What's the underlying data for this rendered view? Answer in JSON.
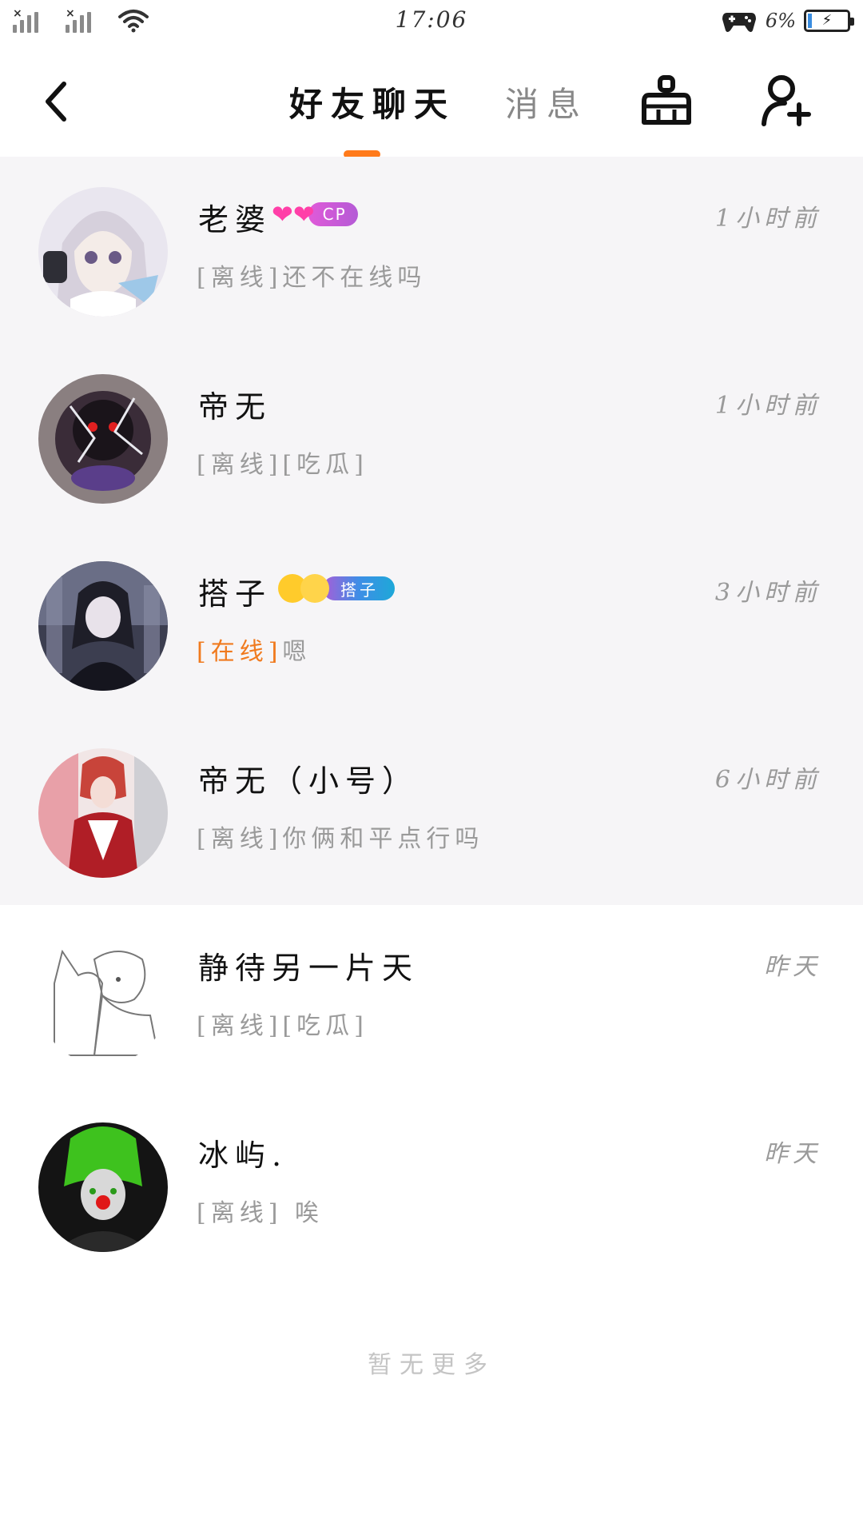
{
  "status_bar": {
    "time": "17:06",
    "battery_pct": "6%",
    "icons": [
      "signal-icon",
      "signal-icon",
      "wifi-icon",
      "game-controller-icon",
      "battery-icon"
    ]
  },
  "header": {
    "back_icon": "chevron-left-icon",
    "tabs": [
      {
        "label": "好友聊天",
        "active": true
      },
      {
        "label": "消息",
        "active": false
      }
    ],
    "clean_icon": "broom-icon",
    "add_friend_icon": "add-user-icon",
    "accent_color": "#ff7a1a"
  },
  "chats": [
    {
      "name": "老婆",
      "badge": "CP",
      "time": "1小时前",
      "status": "[离线]",
      "message": "还不在线吗"
    },
    {
      "name": "帝无",
      "time": "1小时前",
      "status": "[离线]",
      "message": "[吃瓜]"
    },
    {
      "name": "搭子",
      "badge": "搭子",
      "time": "3小时前",
      "status": "[在线]",
      "message": "嗯"
    },
    {
      "name": "帝无（小号）",
      "time": "6小时前",
      "status": "[离线]",
      "message": "你俩和平点行吗"
    },
    {
      "name": "静待另一片天",
      "time": "昨天",
      "status": "[离线]",
      "message": "[吃瓜]"
    },
    {
      "name": "冰屿.",
      "time": "昨天",
      "status": "[离线]",
      "message": " 唉"
    }
  ],
  "footer": "暂无更多"
}
